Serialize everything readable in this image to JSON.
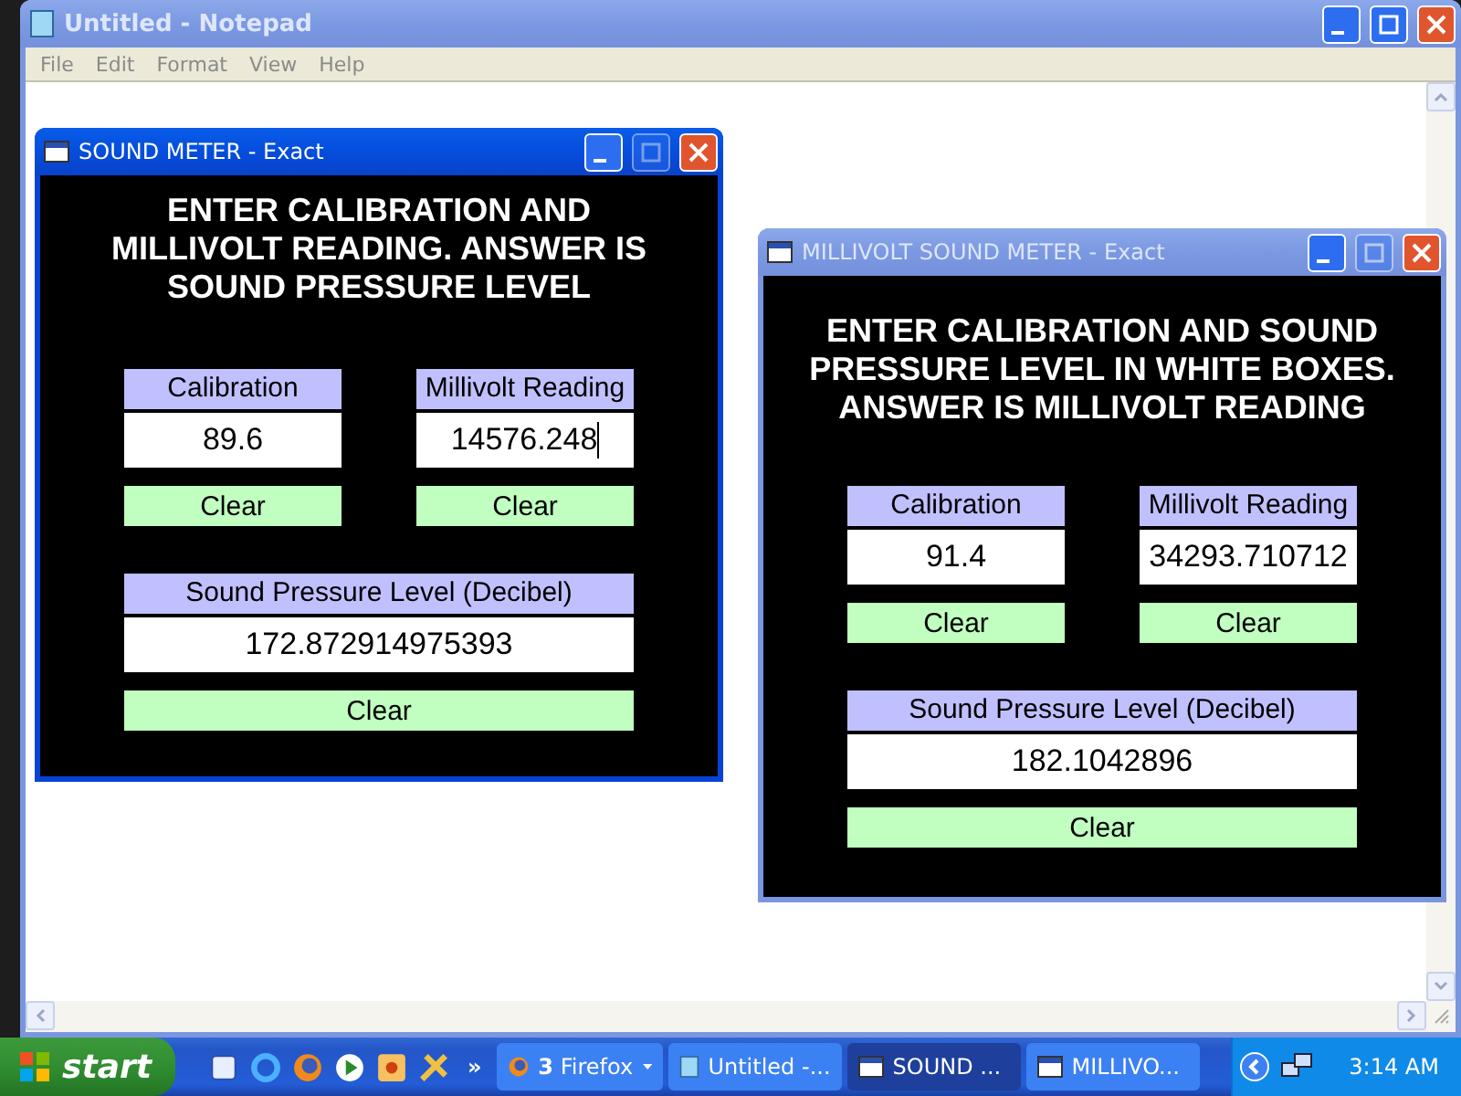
{
  "notepad": {
    "title": "Untitled - Notepad",
    "active": false,
    "menu": [
      "File",
      "Edit",
      "Format",
      "View",
      "Help"
    ]
  },
  "windows": [
    {
      "title": "SOUND METER - Exact",
      "active": true,
      "instructions": [
        "ENTER CALIBRATION AND",
        "MILLIVOLT READING. ANSWER IS",
        "SOUND PRESSURE LEVEL"
      ],
      "fields": [
        {
          "label": "Calibration",
          "value": "89.6",
          "caret": false,
          "button": "Clear"
        },
        {
          "label": "Millivolt Reading",
          "value": "14576.248",
          "caret": true,
          "button": "Clear"
        }
      ],
      "result": {
        "label": "Sound Pressure Level (Decibel)",
        "value": "172.872914975393",
        "button": "Clear"
      }
    },
    {
      "title": "MILLIVOLT SOUND METER - Exact",
      "active": false,
      "instructions": [
        "ENTER CALIBRATION AND SOUND",
        "PRESSURE LEVEL IN WHITE BOXES.",
        "ANSWER IS MILLIVOLT READING"
      ],
      "fields": [
        {
          "label": "Calibration",
          "value": "91.4",
          "caret": false,
          "button": "Clear"
        },
        {
          "label": "Millivolt Reading",
          "value": "34293.710712",
          "caret": false,
          "button": "Clear"
        }
      ],
      "result": {
        "label": "Sound Pressure Level (Decibel)",
        "value": "182.1042896",
        "button": "Clear"
      }
    }
  ],
  "taskbar": {
    "start": "start",
    "more": "»",
    "tasks": [
      {
        "kind": "group",
        "label": "**3** Firefox",
        "selected": false
      },
      {
        "kind": "notepad",
        "label": "Untitled -...",
        "selected": false
      },
      {
        "kind": "app",
        "label": "SOUND ...",
        "selected": true
      },
      {
        "kind": "app",
        "label": "MILLIVO...",
        "selected": false
      }
    ],
    "clock": "3:14 AM"
  }
}
